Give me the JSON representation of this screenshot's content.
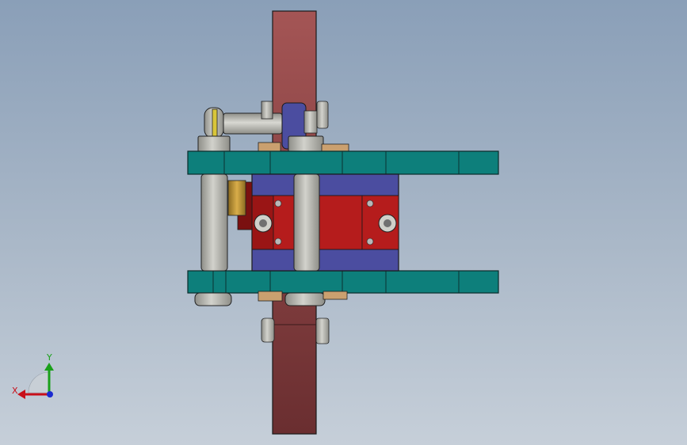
{
  "app": {
    "view": "cad-3d-viewport"
  },
  "triad": {
    "x_label": "X",
    "y_label": "Y",
    "x_color": "#c8101a",
    "y_color": "#1aa01a",
    "z_color": "#1a2ad0"
  },
  "colors": {
    "background_top": "#8a9fb8",
    "background_bottom": "#c6cfd9",
    "vertical_bar": "#a04f50",
    "teal_plate": "#0d7f7b",
    "blue_frame": "#4b4da0",
    "red_block": "#9a1515",
    "steel": "#b9b9b3",
    "brass": "#c9a24d",
    "tan": "#caa06f"
  },
  "icons": {
    "axis_triad": "xyz-triad-icon",
    "screw": "hex-socket-screw-icon"
  }
}
